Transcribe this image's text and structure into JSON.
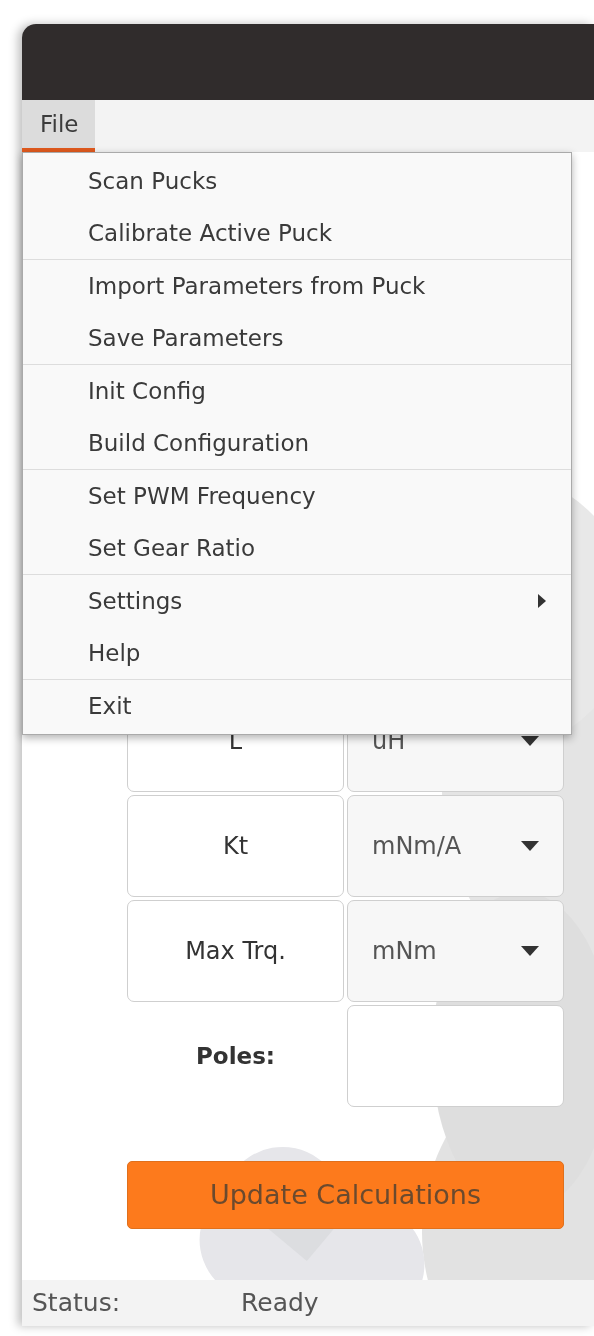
{
  "menubar": [
    {
      "label": "File",
      "selected": true
    }
  ],
  "menu": {
    "groups": [
      [
        {
          "label": "Scan Pucks",
          "has_submenu": false
        },
        {
          "label": "Calibrate Active Puck",
          "has_submenu": false
        }
      ],
      [
        {
          "label": "Import Parameters from Puck",
          "has_submenu": false
        },
        {
          "label": "Save Parameters",
          "has_submenu": false
        }
      ],
      [
        {
          "label": "Init Config",
          "has_submenu": false
        },
        {
          "label": "Build Configuration",
          "has_submenu": false
        }
      ],
      [
        {
          "label": "Set PWM Frequency",
          "has_submenu": false
        },
        {
          "label": "Set Gear Ratio",
          "has_submenu": false
        }
      ],
      [
        {
          "label": "Settings",
          "has_submenu": true
        },
        {
          "label": "Help",
          "has_submenu": false
        }
      ],
      [
        {
          "label": "Exit",
          "has_submenu": false
        }
      ]
    ]
  },
  "parameters": [
    {
      "label": "L",
      "unit": "uH"
    },
    {
      "label": "Kt",
      "unit": "mNm/A"
    },
    {
      "label": "Max Trq.",
      "unit": "mNm"
    }
  ],
  "poles": {
    "label": "Poles:"
  },
  "update_button": "Update Calculations",
  "status_bar": {
    "label": "Status:",
    "value": "Ready"
  }
}
